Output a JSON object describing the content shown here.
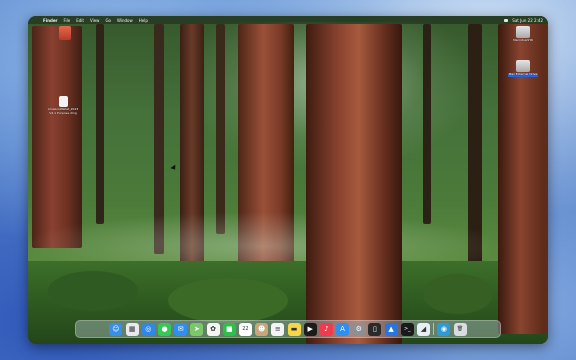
{
  "menubar": {
    "apple": "",
    "items": [
      "Finder",
      "File",
      "Edit",
      "View",
      "Go",
      "Window",
      "Help"
    ],
    "clock": "Sat Jun 22 2:42"
  },
  "desktop_icons": [
    {
      "label": "",
      "kind": "app-icon"
    },
    {
      "label": "AmazonWallet_2023 V4.1 Purpose.dmg",
      "kind": "document-icon"
    },
    {
      "label": "MacintoshHD",
      "kind": "drive-icon"
    },
    {
      "label": "Mac External Drive",
      "kind": "drive-icon",
      "selected": true
    }
  ],
  "dock": {
    "apps": [
      {
        "name": "finder-icon",
        "glyph": "☺",
        "color": "#3a8ee6"
      },
      {
        "name": "launchpad-icon",
        "glyph": "▦",
        "color": "#e9e9ef"
      },
      {
        "name": "safari-icon",
        "glyph": "◎",
        "color": "#2f87ea"
      },
      {
        "name": "messages-icon",
        "glyph": "●",
        "color": "#35c759"
      },
      {
        "name": "mail-icon",
        "glyph": "✉",
        "color": "#2f8ff0"
      },
      {
        "name": "maps-icon",
        "glyph": "➤",
        "color": "#7ac86a"
      },
      {
        "name": "photos-icon",
        "glyph": "✿",
        "color": "#f5f5f5"
      },
      {
        "name": "facetime-icon",
        "glyph": "■",
        "color": "#2cbf4a"
      },
      {
        "name": "calendar-icon",
        "glyph": "22",
        "color": "#ffffff"
      },
      {
        "name": "contacts-icon",
        "glyph": "☻",
        "color": "#c8a57a"
      },
      {
        "name": "reminders-icon",
        "glyph": "≡",
        "color": "#f4f4f4"
      },
      {
        "name": "notes-icon",
        "glyph": "▬",
        "color": "#f9d548"
      },
      {
        "name": "tv-icon",
        "glyph": "▶",
        "color": "#1b1b1b"
      },
      {
        "name": "music-icon",
        "glyph": "♪",
        "color": "#f2394d"
      },
      {
        "name": "app-store-icon",
        "glyph": "A",
        "color": "#2f8ff0"
      },
      {
        "name": "system-settings-icon",
        "glyph": "⚙",
        "color": "#8e8e93"
      },
      {
        "name": "iphone-mirroring-icon",
        "glyph": "▯",
        "color": "#2a2a2a"
      },
      {
        "name": "keynote-icon",
        "glyph": "▲",
        "color": "#2a74e0"
      },
      {
        "name": "terminal-icon",
        "glyph": ">_",
        "color": "#1a1a1a"
      },
      {
        "name": "preview-icon",
        "glyph": "◢",
        "color": "#e8eef5"
      }
    ],
    "right": [
      {
        "name": "screenshot-icon",
        "glyph": "◉",
        "color": "#2e9bd9"
      },
      {
        "name": "trash-icon",
        "glyph": "🗑",
        "color": "#d9dde2"
      }
    ]
  }
}
